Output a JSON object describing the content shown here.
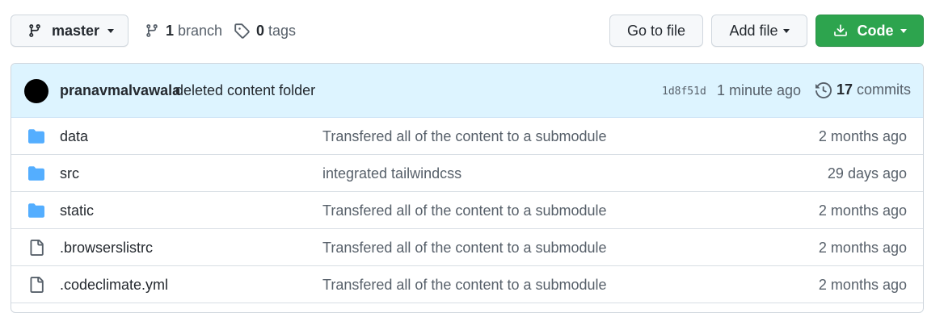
{
  "toolbar": {
    "branch_button": "master",
    "branches_count": "1",
    "branches_label": "branch",
    "tags_count": "0",
    "tags_label": "tags",
    "goto_file": "Go to file",
    "add_file": "Add file",
    "code": "Code"
  },
  "commit": {
    "author": "pranavmalvawala",
    "message": "deleted content folder",
    "sha": "1d8f51d",
    "time": "1 minute ago",
    "commits_count": "17",
    "commits_label": "commits"
  },
  "files": [
    {
      "name": "data",
      "type": "folder",
      "message": "Transfered all of the content to a submodule",
      "time": "2 months ago"
    },
    {
      "name": "src",
      "type": "folder",
      "message": "integrated tailwindcss",
      "time": "29 days ago"
    },
    {
      "name": "static",
      "type": "folder",
      "message": "Transfered all of the content to a submodule",
      "time": "2 months ago"
    },
    {
      "name": ".browserslistrc",
      "type": "file",
      "message": "Transfered all of the content to a submodule",
      "time": "2 months ago"
    },
    {
      "name": ".codeclimate.yml",
      "type": "file",
      "message": "Transfered all of the content to a submodule",
      "time": "2 months ago"
    }
  ],
  "colors": {
    "primary_button": "#2da44e",
    "commit_bar": "#ddf4ff",
    "folder_icon": "#54aeff"
  }
}
